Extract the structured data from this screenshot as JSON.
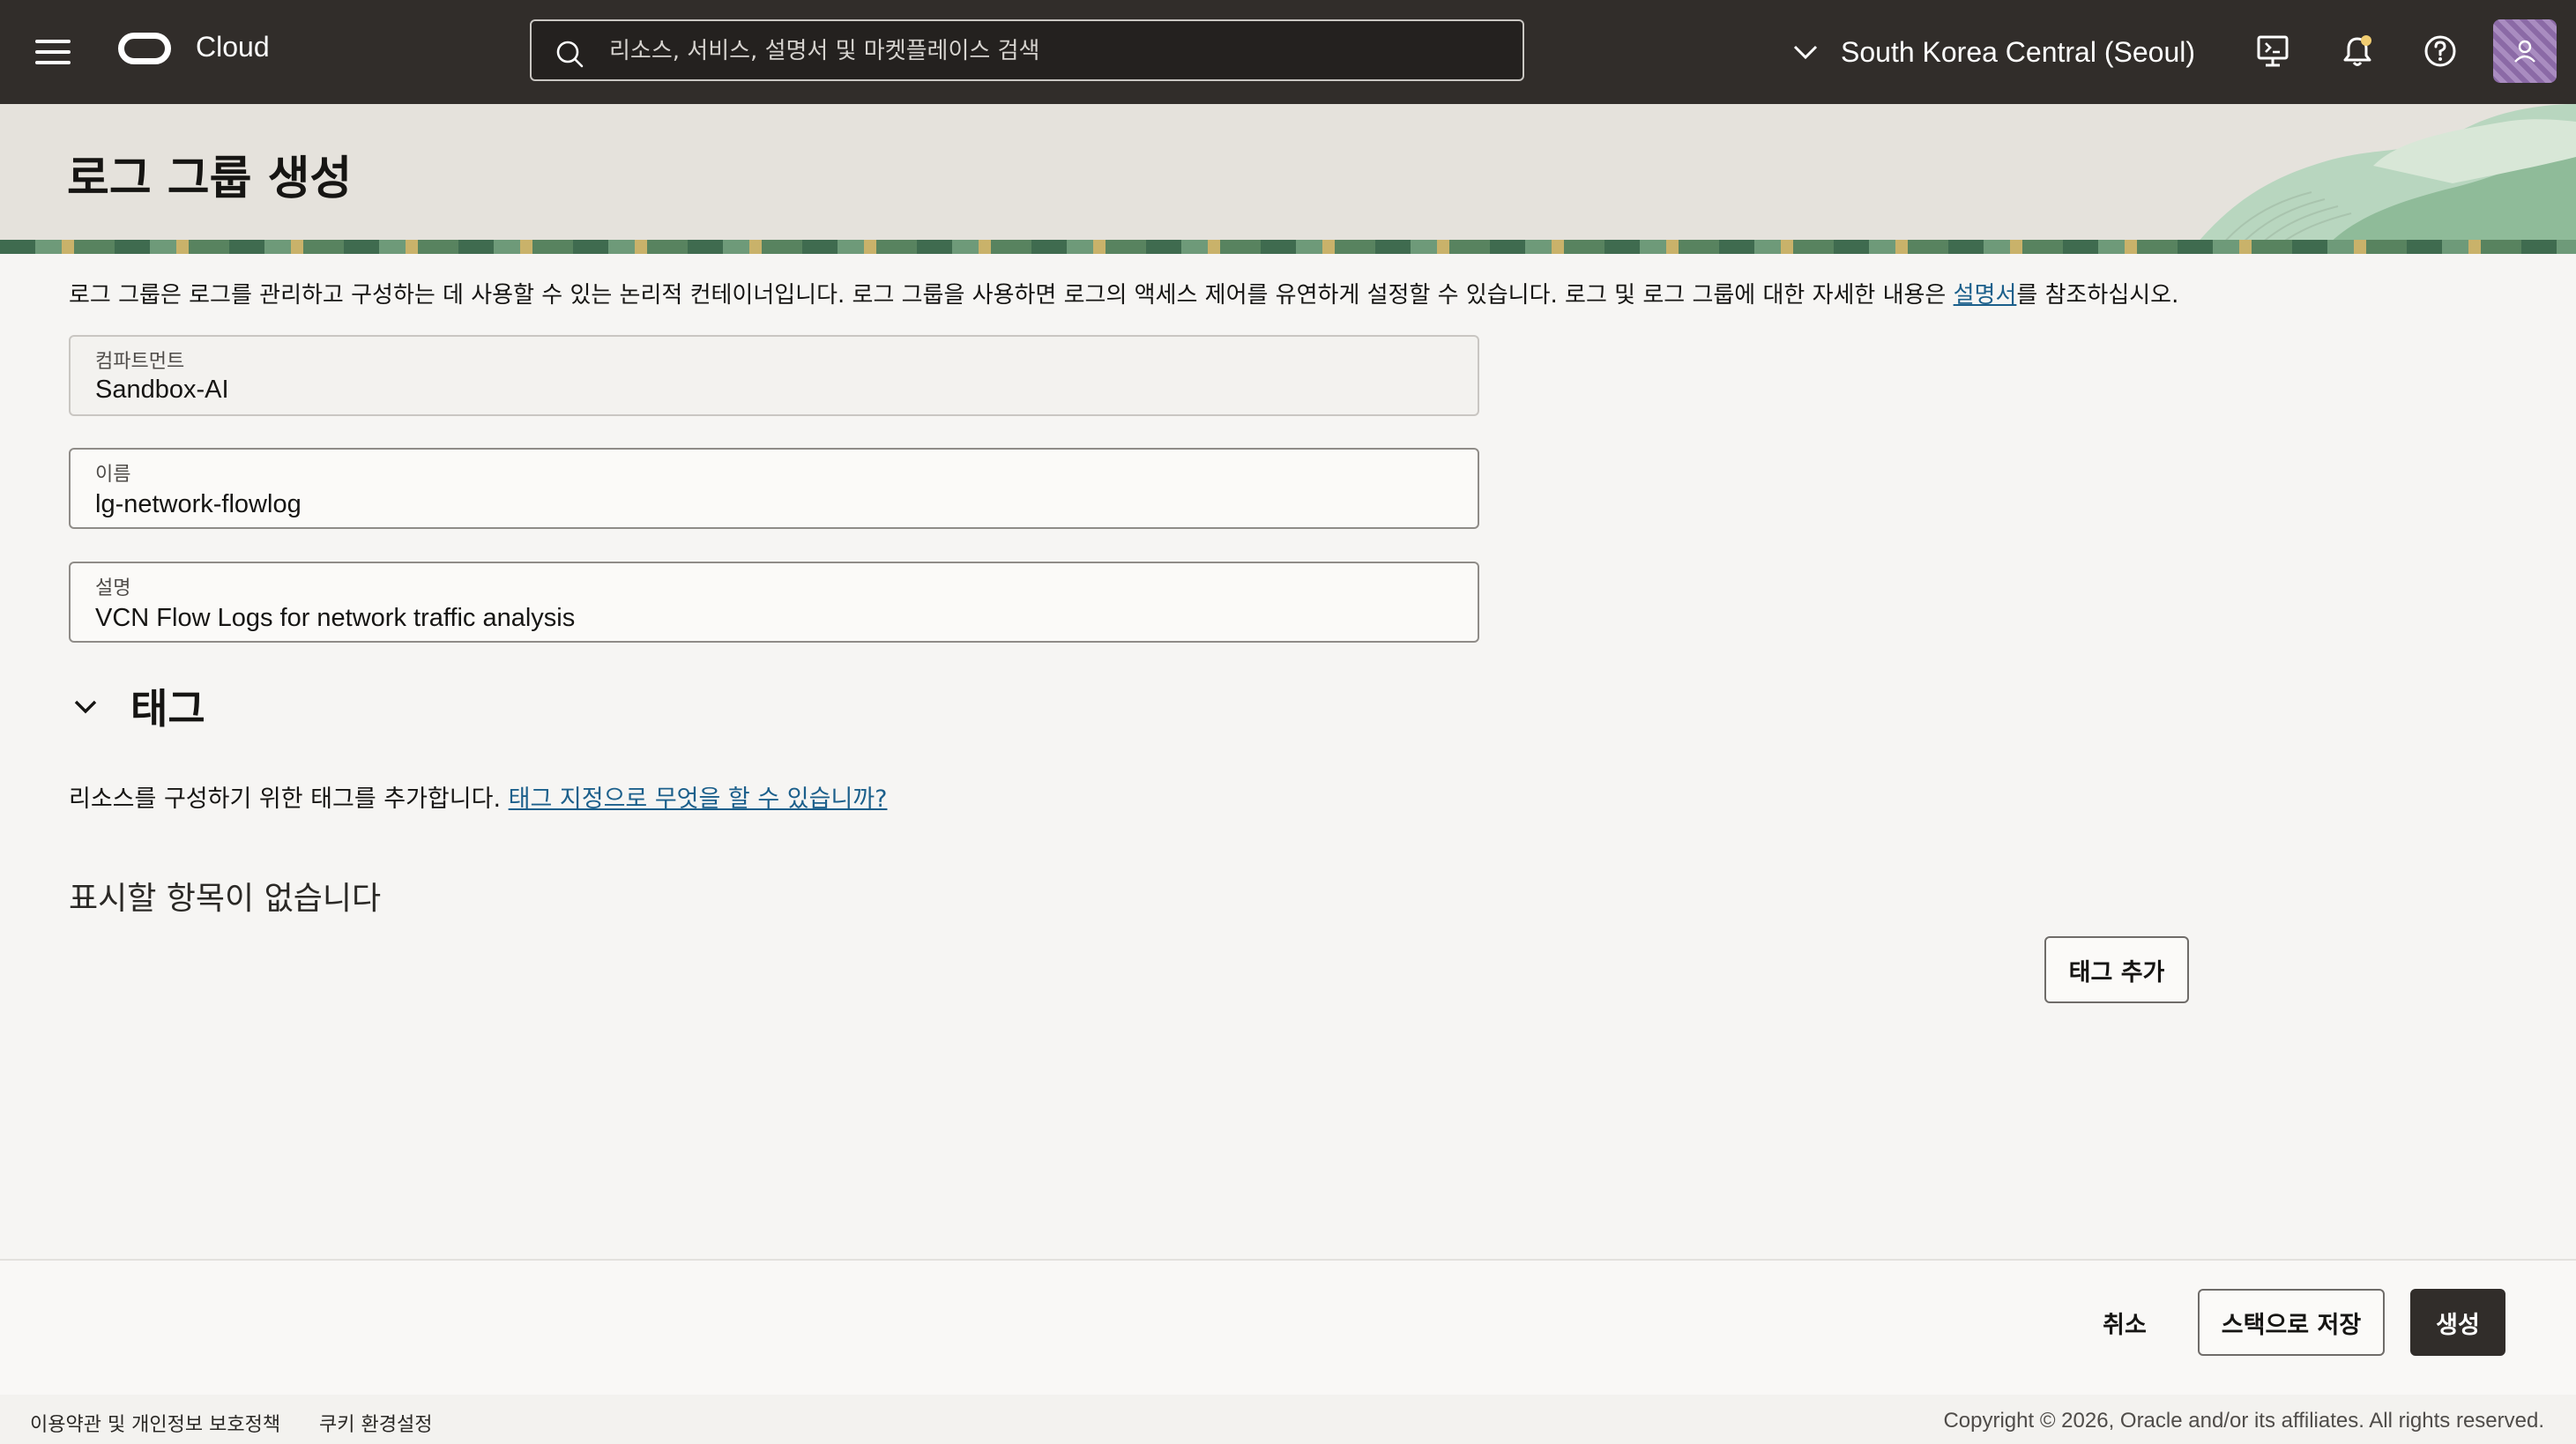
{
  "topbar": {
    "brand": "Cloud",
    "search_placeholder": "리소스, 서비스, 설명서 및 마켓플레이스 검색",
    "region": "South Korea Central (Seoul)"
  },
  "page": {
    "title": "로그 그룹 생성",
    "intro_text": "로그 그룹은 로그를 관리하고 구성하는 데 사용할 수 있는 논리적 컨테이너입니다. 로그 그룹을 사용하면 로그의 액세스 제어를 유연하게 설정할 수 있습니다. 로그 및 로그 그룹에 대한 자세한 내용은 ",
    "intro_link": "설명서",
    "intro_suffix": "를 참조하십시오."
  },
  "form": {
    "compartment": {
      "label": "컴파트먼트",
      "value": "Sandbox-AI"
    },
    "name": {
      "label": "이름",
      "value": "lg-network-flowlog"
    },
    "description": {
      "label": "설명",
      "value": "VCN Flow Logs for network traffic analysis"
    }
  },
  "tags": {
    "title": "태그",
    "description": "리소스를 구성하기 위한 태그를 추가합니다. ",
    "help_link": "태그 지정으로 무엇을 할 수 있습니까?",
    "empty_message": "표시할 항목이 없습니다",
    "add_button": "태그 추가"
  },
  "actions": {
    "cancel": "취소",
    "save_as_stack": "스택으로 저장",
    "create": "생성"
  },
  "footer": {
    "terms": "이용약관 및 개인정보 보호정책",
    "cookies": "쿠키 환경설정",
    "copyright": "Copyright © 2026, Oracle and/or its affiliates. All rights reserved."
  },
  "colors": {
    "topbar_bg": "#312d2a",
    "link": "#1b5f8b",
    "primary_button": "#312d2a",
    "notification_dot": "#f0cc71"
  }
}
